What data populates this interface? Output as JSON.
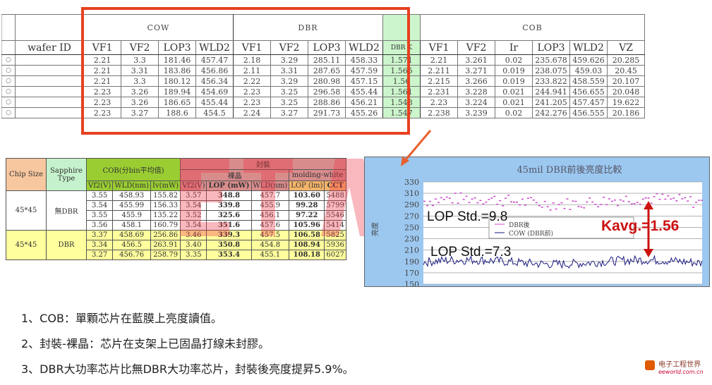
{
  "top_table": {
    "groups": {
      "cow": "COW",
      "dbr": "DBR",
      "cob": "COB"
    },
    "headers": [
      "wafer ID",
      "VF1",
      "VF2",
      "LOP3",
      "WLD2",
      "VF1",
      "VF2",
      "LOP3",
      "WLD2",
      "DBR K",
      "VF1",
      "VF2",
      "Ir",
      "LOP3",
      "WLD2",
      "VZ"
    ],
    "rows": [
      [
        "2.21",
        "3.3",
        "181.46",
        "457.47",
        "2.18",
        "3.29",
        "285.11",
        "458.33",
        "1.571",
        "2.21",
        "3.261",
        "0.02",
        "235.678",
        "459.626",
        "20.285"
      ],
      [
        "2.21",
        "3.31",
        "183.86",
        "456.86",
        "2.11",
        "3.31",
        "287.65",
        "457.59",
        "1.565",
        "2.211",
        "3.271",
        "0.019",
        "238.075",
        "459.03",
        "20.45"
      ],
      [
        "2.21",
        "3.3",
        "180.12",
        "456.34",
        "2.22",
        "3.29",
        "280.98",
        "457.15",
        "1.56",
        "2.215",
        "3.266",
        "0.019",
        "233.822",
        "458.559",
        "20.107"
      ],
      [
        "2.23",
        "3.26",
        "189.94",
        "454.69",
        "2.23",
        "3.25",
        "296.58",
        "455.44",
        "1.561",
        "2.231",
        "3.228",
        "0.021",
        "244.941",
        "456.655",
        "20.048"
      ],
      [
        "2.23",
        "3.26",
        "186.65",
        "455.44",
        "2.23",
        "3.25",
        "288.86",
        "456.21",
        "1.548",
        "2.23",
        "3.224",
        "0.021",
        "241.205",
        "457.457",
        "19.622"
      ],
      [
        "2.23",
        "3.27",
        "188.6",
        "454.5",
        "2.24",
        "3.27",
        "291.73",
        "455.26",
        "1.547",
        "2.238",
        "3.239",
        "0.02",
        "242.276",
        "456.555",
        "20.186"
      ]
    ],
    "row_marker": "○"
  },
  "mid_table": {
    "headers": {
      "chip_size": "Chip Size",
      "sapphire": "Sapphire Type",
      "cob": "COB(分bin平均值)",
      "pkg": "封裝",
      "bare": "裸晶",
      "mold": "molding-white",
      "cols": [
        "Vf2(V)",
        "WLD(nm)",
        "Iv(mW)",
        "Vf2(V)",
        "LOP (mW)",
        "WLD(nm)",
        "LOP (lm)",
        "CCT"
      ]
    },
    "groups": [
      {
        "chip": "45*45",
        "type": "無DBR",
        "rows": [
          [
            "3.55",
            "458.93",
            "155.82",
            "3.57",
            "348.8",
            "457.7",
            "103.60",
            "5488"
          ],
          [
            "3.54",
            "455.99",
            "156.33",
            "3.54",
            "339.8",
            "455.9",
            "99.28",
            "5799"
          ],
          [
            "3.55",
            "455.9",
            "135.22",
            "3.52",
            "325.6",
            "456.1",
            "97.22",
            "5546"
          ],
          [
            "3.56",
            "458.1",
            "160.79",
            "3.54",
            "351.6",
            "457.6",
            "105.96",
            "5414"
          ]
        ]
      },
      {
        "chip": "45*45",
        "type": "DBR",
        "rows": [
          [
            "3.37",
            "458.69",
            "256.86",
            "3.46",
            "339.3",
            "457.5",
            "106.58",
            "5825"
          ],
          [
            "3.34",
            "456.5",
            "263.91",
            "3.40",
            "350.8",
            "454.8",
            "108.94",
            "5936"
          ],
          [
            "3.27",
            "456.76",
            "258.79",
            "3.35",
            "353.4",
            "455.1",
            "108.18",
            "6027"
          ]
        ]
      }
    ]
  },
  "chart_data": {
    "type": "line",
    "title": "45mil DBR前後亮度比較",
    "ylabel": "亮度",
    "ylim": [
      150,
      330
    ],
    "yticks": [
      330,
      310,
      290,
      270,
      250,
      230,
      210,
      190,
      170,
      150
    ],
    "legend": [
      "DBR後",
      "COW (DBR前)"
    ],
    "legend_position": "center",
    "series": [
      {
        "name": "DBR後",
        "color": "#cc44cc",
        "mean": 297,
        "std": 9.8
      },
      {
        "name": "COW (DBR前)",
        "color": "#1a1a80",
        "mean": 189,
        "std": 7.3
      }
    ],
    "annotations": [
      "LOP Std.=9.8",
      "LOP Std.=7.3",
      "Kavg.=1.56"
    ]
  },
  "notes": [
    "1、COB：單顆芯片在藍膜上亮度讀值。",
    "2、封裝-裸晶：芯片在支架上已固晶打線未封膠。",
    "3、DBR大功率芯片比無DBR大功率芯片，封裝後亮度提昇5.9%。"
  ],
  "logo": {
    "title": "电子工程世界",
    "site": "eeworld.com.cn"
  },
  "colors": {
    "red_box": "#e8401f",
    "green": "#ccf5cc",
    "kavg": "#cc1111"
  }
}
